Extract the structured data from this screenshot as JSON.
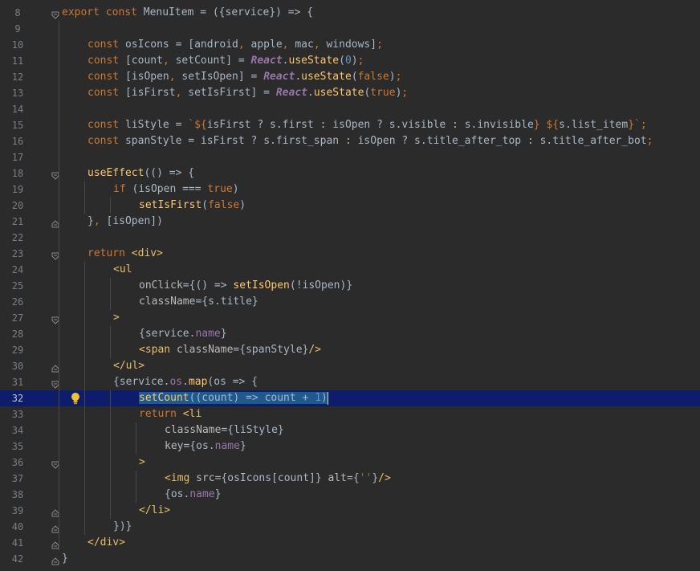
{
  "editor": {
    "current_line": 32,
    "lines": [
      {
        "num": 8,
        "indent": 0,
        "fold": "open",
        "tokens": [
          [
            "kw",
            "export const "
          ],
          [
            "id",
            "MenuItem "
          ],
          [
            "punc",
            "= ({"
          ],
          [
            "id",
            "service"
          ],
          [
            "punc",
            "}) => {"
          ]
        ]
      },
      {
        "num": 9,
        "indent": 0,
        "fold": "",
        "tokens": []
      },
      {
        "num": 10,
        "indent": 1,
        "fold": "",
        "tokens": [
          [
            "kw",
            "const "
          ],
          [
            "id",
            "osIcons "
          ],
          [
            "punc",
            "= ["
          ],
          [
            "id",
            "android"
          ],
          [
            "kw",
            ", "
          ],
          [
            "id",
            "apple"
          ],
          [
            "kw",
            ", "
          ],
          [
            "id",
            "mac"
          ],
          [
            "kw",
            ", "
          ],
          [
            "id",
            "windows"
          ],
          [
            "punc",
            "]"
          ],
          [
            "kw",
            ";"
          ]
        ]
      },
      {
        "num": 11,
        "indent": 1,
        "fold": "",
        "tokens": [
          [
            "kw",
            "const "
          ],
          [
            "punc",
            "["
          ],
          [
            "id",
            "count"
          ],
          [
            "kw",
            ", "
          ],
          [
            "id",
            "setCount"
          ],
          [
            "punc",
            "] = "
          ],
          [
            "react",
            "React"
          ],
          [
            "punc",
            "."
          ],
          [
            "fn",
            "useState"
          ],
          [
            "punc",
            "("
          ],
          [
            "num",
            "0"
          ],
          [
            "punc",
            ")"
          ],
          [
            "kw",
            ";"
          ]
        ]
      },
      {
        "num": 12,
        "indent": 1,
        "fold": "",
        "tokens": [
          [
            "kw",
            "const "
          ],
          [
            "punc",
            "["
          ],
          [
            "id",
            "isOpen"
          ],
          [
            "kw",
            ", "
          ],
          [
            "id",
            "setIsOpen"
          ],
          [
            "punc",
            "] = "
          ],
          [
            "react",
            "React"
          ],
          [
            "punc",
            "."
          ],
          [
            "fn",
            "useState"
          ],
          [
            "punc",
            "("
          ],
          [
            "kw",
            "false"
          ],
          [
            "punc",
            ")"
          ],
          [
            "kw",
            ";"
          ]
        ]
      },
      {
        "num": 13,
        "indent": 1,
        "fold": "",
        "tokens": [
          [
            "kw",
            "const "
          ],
          [
            "punc",
            "["
          ],
          [
            "id",
            "isFirst"
          ],
          [
            "kw",
            ", "
          ],
          [
            "id",
            "setIsFirst"
          ],
          [
            "punc",
            "] = "
          ],
          [
            "react",
            "React"
          ],
          [
            "punc",
            "."
          ],
          [
            "fn",
            "useState"
          ],
          [
            "punc",
            "("
          ],
          [
            "kw",
            "true"
          ],
          [
            "punc",
            ")"
          ],
          [
            "kw",
            ";"
          ]
        ]
      },
      {
        "num": 14,
        "indent": 0,
        "fold": "",
        "tokens": []
      },
      {
        "num": 15,
        "indent": 1,
        "fold": "",
        "tokens": [
          [
            "kw",
            "const "
          ],
          [
            "id",
            "liStyle "
          ],
          [
            "punc",
            "= "
          ],
          [
            "str",
            "`"
          ],
          [
            "kw",
            "${"
          ],
          [
            "id",
            "isFirst "
          ],
          [
            "punc",
            "? "
          ],
          [
            "id",
            "s"
          ],
          [
            "punc",
            "."
          ],
          [
            "id",
            "first "
          ],
          [
            "punc",
            ": "
          ],
          [
            "id",
            "isOpen "
          ],
          [
            "punc",
            "? "
          ],
          [
            "id",
            "s"
          ],
          [
            "punc",
            "."
          ],
          [
            "id",
            "visible "
          ],
          [
            "punc",
            ": "
          ],
          [
            "id",
            "s"
          ],
          [
            "punc",
            "."
          ],
          [
            "id",
            "invisible"
          ],
          [
            "kw",
            "} ${"
          ],
          [
            "id",
            "s"
          ],
          [
            "punc",
            "."
          ],
          [
            "id",
            "list_item"
          ],
          [
            "kw",
            "}"
          ],
          [
            "str",
            "`"
          ],
          [
            "kw",
            ";"
          ]
        ]
      },
      {
        "num": 16,
        "indent": 1,
        "fold": "",
        "tokens": [
          [
            "kw",
            "const "
          ],
          [
            "id",
            "spanStyle "
          ],
          [
            "punc",
            "= "
          ],
          [
            "id",
            "isFirst "
          ],
          [
            "punc",
            "? "
          ],
          [
            "id",
            "s"
          ],
          [
            "punc",
            "."
          ],
          [
            "id",
            "first_span "
          ],
          [
            "punc",
            ": "
          ],
          [
            "id",
            "isOpen "
          ],
          [
            "punc",
            "? "
          ],
          [
            "id",
            "s"
          ],
          [
            "punc",
            "."
          ],
          [
            "id",
            "title_after_top "
          ],
          [
            "punc",
            ": "
          ],
          [
            "id",
            "s"
          ],
          [
            "punc",
            "."
          ],
          [
            "id",
            "title_after_bot"
          ],
          [
            "kw",
            ";"
          ]
        ]
      },
      {
        "num": 17,
        "indent": 0,
        "fold": "",
        "tokens": []
      },
      {
        "num": 18,
        "indent": 1,
        "fold": "open",
        "tokens": [
          [
            "fn",
            "useEffect"
          ],
          [
            "punc",
            "(() => {"
          ]
        ]
      },
      {
        "num": 19,
        "indent": 2,
        "fold": "",
        "tokens": [
          [
            "kw",
            "if "
          ],
          [
            "punc",
            "("
          ],
          [
            "id",
            "isOpen "
          ],
          [
            "punc",
            "=== "
          ],
          [
            "kw",
            "true"
          ],
          [
            "punc",
            ")"
          ]
        ]
      },
      {
        "num": 20,
        "indent": 3,
        "fold": "",
        "tokens": [
          [
            "fn",
            "setIsFirst"
          ],
          [
            "punc",
            "("
          ],
          [
            "kw",
            "false"
          ],
          [
            "punc",
            ")"
          ]
        ]
      },
      {
        "num": 21,
        "indent": 1,
        "fold": "close",
        "tokens": [
          [
            "punc",
            "}"
          ],
          [
            "kw",
            ", "
          ],
          [
            "punc",
            "["
          ],
          [
            "id",
            "isOpen"
          ],
          [
            "punc",
            "])"
          ]
        ]
      },
      {
        "num": 22,
        "indent": 0,
        "fold": "",
        "tokens": []
      },
      {
        "num": 23,
        "indent": 1,
        "fold": "open",
        "tokens": [
          [
            "kw",
            "return "
          ],
          [
            "tag",
            "<div>"
          ]
        ]
      },
      {
        "num": 24,
        "indent": 2,
        "fold": "",
        "tokens": [
          [
            "tag",
            "<ul"
          ]
        ]
      },
      {
        "num": 25,
        "indent": 3,
        "fold": "",
        "tokens": [
          [
            "attr",
            "onClick"
          ],
          [
            "punc",
            "={() => "
          ],
          [
            "fn",
            "setIsOpen"
          ],
          [
            "punc",
            "(!"
          ],
          [
            "id",
            "isOpen"
          ],
          [
            "punc",
            ")}"
          ]
        ]
      },
      {
        "num": 26,
        "indent": 3,
        "fold": "",
        "tokens": [
          [
            "attr",
            "className"
          ],
          [
            "punc",
            "={"
          ],
          [
            "id",
            "s"
          ],
          [
            "punc",
            "."
          ],
          [
            "id",
            "title"
          ],
          [
            "punc",
            "}"
          ]
        ]
      },
      {
        "num": 27,
        "indent": 2,
        "fold": "open",
        "tokens": [
          [
            "tag",
            ">"
          ]
        ]
      },
      {
        "num": 28,
        "indent": 3,
        "fold": "",
        "tokens": [
          [
            "punc",
            "{"
          ],
          [
            "id",
            "service"
          ],
          [
            "punc",
            "."
          ],
          [
            "prop",
            "name"
          ],
          [
            "punc",
            "}"
          ]
        ]
      },
      {
        "num": 29,
        "indent": 3,
        "fold": "",
        "tokens": [
          [
            "tag",
            "<span "
          ],
          [
            "attr",
            "className"
          ],
          [
            "punc",
            "={"
          ],
          [
            "id",
            "spanStyle"
          ],
          [
            "punc",
            "}"
          ],
          [
            "tag",
            "/>"
          ]
        ]
      },
      {
        "num": 30,
        "indent": 2,
        "fold": "close",
        "tokens": [
          [
            "tag",
            "</ul>"
          ]
        ]
      },
      {
        "num": 31,
        "indent": 2,
        "fold": "open",
        "tokens": [
          [
            "punc",
            "{"
          ],
          [
            "id",
            "service"
          ],
          [
            "punc",
            "."
          ],
          [
            "prop",
            "os"
          ],
          [
            "punc",
            "."
          ],
          [
            "fn",
            "map"
          ],
          [
            "punc",
            "("
          ],
          [
            "id",
            "os "
          ],
          [
            "punc",
            "=> {"
          ]
        ]
      },
      {
        "num": 32,
        "indent": 3,
        "fold": "",
        "selected": true,
        "tokens": [
          [
            "fn",
            "setCount"
          ],
          [
            "punc",
            "(("
          ],
          [
            "id",
            "count"
          ],
          [
            "punc",
            ") => "
          ],
          [
            "id",
            "count "
          ],
          [
            "punc",
            "+ "
          ],
          [
            "num",
            "1"
          ],
          [
            "punc",
            ")"
          ]
        ]
      },
      {
        "num": 33,
        "indent": 3,
        "fold": "",
        "tokens": [
          [
            "kw",
            "return "
          ],
          [
            "tag",
            "<li"
          ]
        ]
      },
      {
        "num": 34,
        "indent": 4,
        "fold": "",
        "tokens": [
          [
            "attr",
            "className"
          ],
          [
            "punc",
            "={"
          ],
          [
            "id",
            "liStyle"
          ],
          [
            "punc",
            "}"
          ]
        ]
      },
      {
        "num": 35,
        "indent": 4,
        "fold": "",
        "tokens": [
          [
            "attr",
            "key"
          ],
          [
            "punc",
            "={"
          ],
          [
            "id",
            "os"
          ],
          [
            "punc",
            "."
          ],
          [
            "prop",
            "name"
          ],
          [
            "punc",
            "}"
          ]
        ]
      },
      {
        "num": 36,
        "indent": 3,
        "fold": "open",
        "tokens": [
          [
            "tag",
            ">"
          ]
        ]
      },
      {
        "num": 37,
        "indent": 4,
        "fold": "",
        "tokens": [
          [
            "tag",
            "<img "
          ],
          [
            "attr",
            "src"
          ],
          [
            "punc",
            "={"
          ],
          [
            "id",
            "osIcons"
          ],
          [
            "punc",
            "["
          ],
          [
            "id",
            "count"
          ],
          [
            "punc",
            "]} "
          ],
          [
            "attr",
            "alt"
          ],
          [
            "punc",
            "={"
          ],
          [
            "str",
            "''"
          ],
          [
            "punc",
            "}"
          ],
          [
            "tag",
            "/>"
          ]
        ]
      },
      {
        "num": 38,
        "indent": 4,
        "fold": "",
        "tokens": [
          [
            "punc",
            "{"
          ],
          [
            "id",
            "os"
          ],
          [
            "punc",
            "."
          ],
          [
            "prop",
            "name"
          ],
          [
            "punc",
            "}"
          ]
        ]
      },
      {
        "num": 39,
        "indent": 3,
        "fold": "close",
        "tokens": [
          [
            "tag",
            "</li>"
          ]
        ]
      },
      {
        "num": 40,
        "indent": 2,
        "fold": "close",
        "tokens": [
          [
            "punc",
            "})}"
          ]
        ]
      },
      {
        "num": 41,
        "indent": 1,
        "fold": "close",
        "tokens": [
          [
            "tag",
            "</div>"
          ]
        ]
      },
      {
        "num": 42,
        "indent": 0,
        "fold": "close",
        "tokens": [
          [
            "punc",
            "}"
          ]
        ]
      }
    ]
  },
  "colors": {
    "background": "#2b2b2b",
    "current_line": "#0d1c6b",
    "selection": "#1f5a8f",
    "bulb": "#f2c230"
  },
  "icons": {
    "fold_open": "fold-open-icon",
    "fold_close": "fold-close-icon",
    "intention": "lightbulb-icon"
  }
}
